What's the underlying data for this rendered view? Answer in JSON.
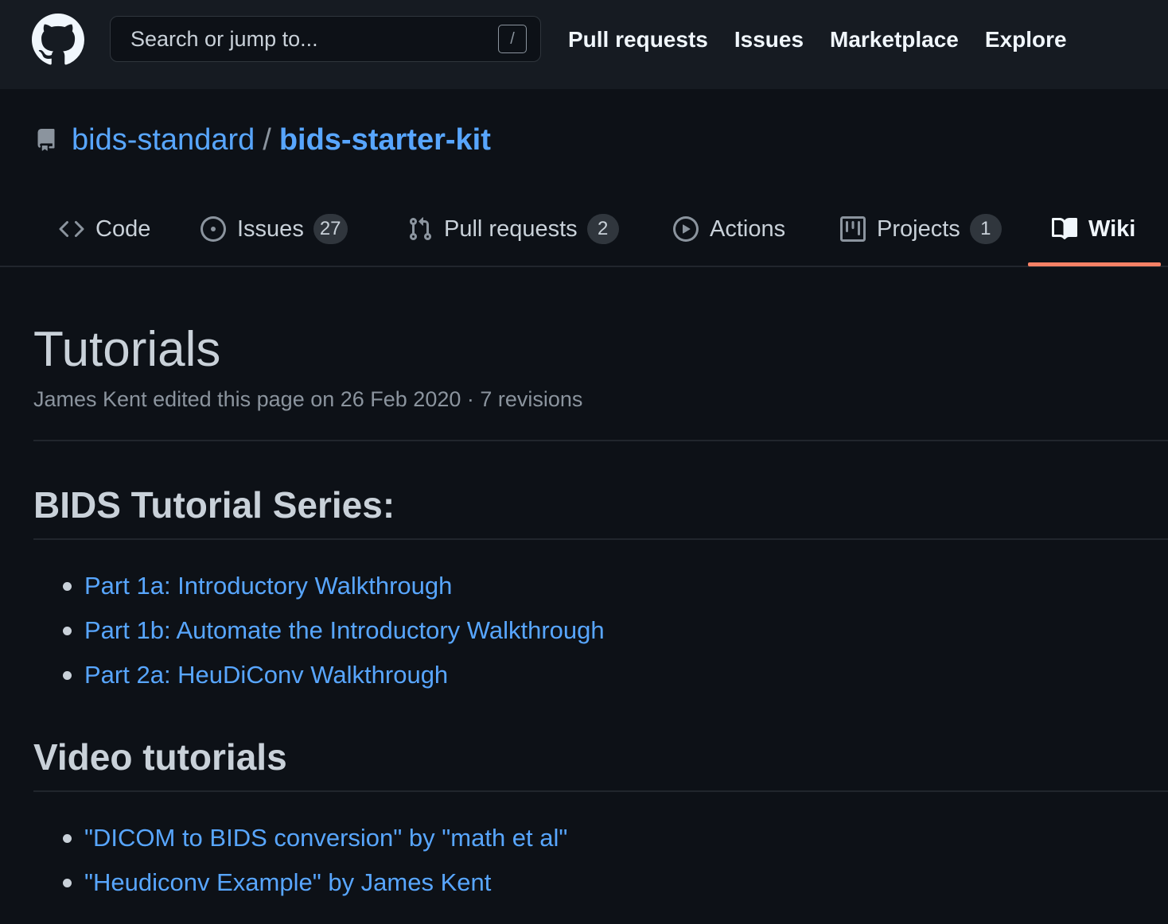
{
  "header": {
    "search_placeholder": "Search or jump to...",
    "search_shortcut": "/",
    "nav": [
      {
        "label": "Pull requests"
      },
      {
        "label": "Issues"
      },
      {
        "label": "Marketplace"
      },
      {
        "label": "Explore"
      }
    ]
  },
  "repo": {
    "owner": "bids-standard",
    "separator": "/",
    "name": "bids-starter-kit"
  },
  "tabs": [
    {
      "label": "Code",
      "icon": "code-icon"
    },
    {
      "label": "Issues",
      "icon": "issue-opened-icon",
      "count": "27"
    },
    {
      "label": "Pull requests",
      "icon": "git-pull-request-icon",
      "count": "2"
    },
    {
      "label": "Actions",
      "icon": "play-icon"
    },
    {
      "label": "Projects",
      "icon": "project-icon",
      "count": "1"
    },
    {
      "label": "Wiki",
      "icon": "book-icon",
      "selected": true
    }
  ],
  "wiki": {
    "title": "Tutorials",
    "meta": "James Kent edited this page on 26 Feb 2020 · 7 revisions",
    "sections": [
      {
        "heading": "BIDS Tutorial Series:",
        "links": [
          "Part 1a: Introductory Walkthrough",
          "Part 1b: Automate the Introductory Walkthrough",
          "Part 2a: HeuDiConv Walkthrough"
        ]
      },
      {
        "heading": "Video tutorials",
        "links": [
          "\"DICOM to BIDS conversion\" by \"math et al\"",
          "\"Heudiconv Example\" by James Kent"
        ]
      }
    ]
  },
  "colors": {
    "background": "#0d1117",
    "header_bg": "#161b22",
    "link": "#58a6ff",
    "text": "#c9d1d9",
    "muted": "#8b949e",
    "selected_tab_underline": "#f78166"
  }
}
